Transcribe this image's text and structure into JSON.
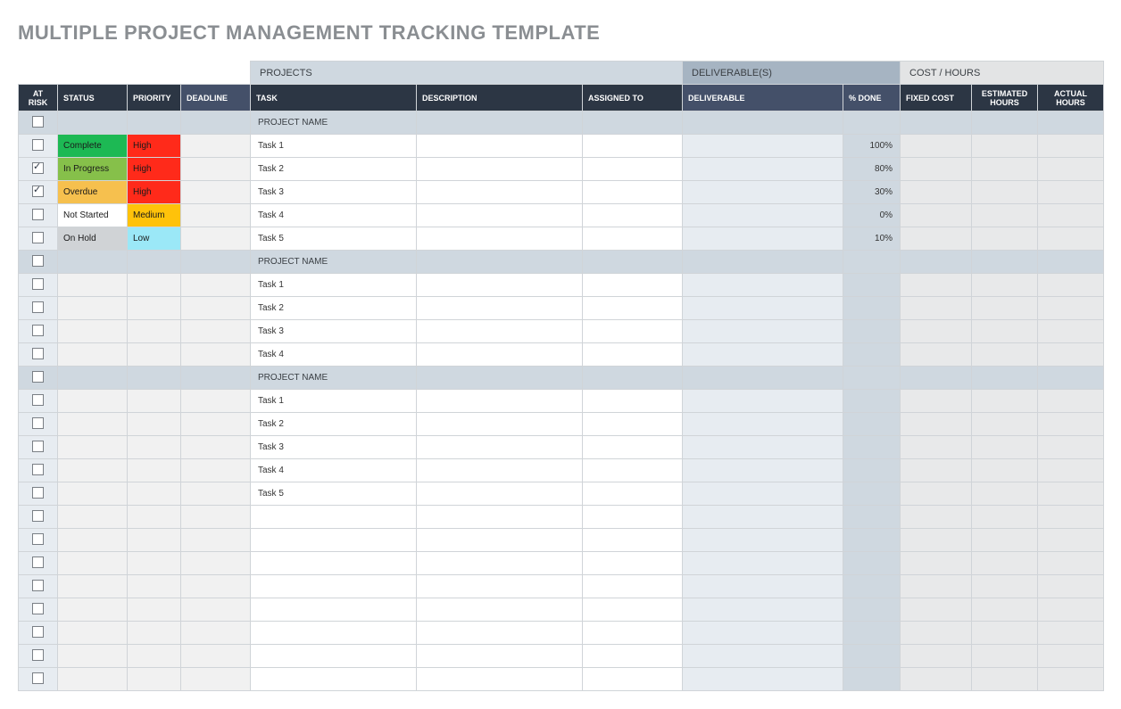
{
  "title": "MULTIPLE PROJECT MANAGEMENT TRACKING TEMPLATE",
  "groups": {
    "projects": "PROJECTS",
    "deliverables": "DELIVERABLE(S)",
    "cost": "COST / HOURS"
  },
  "columns": {
    "at_risk": "AT RISK",
    "status": "STATUS",
    "priority": "PRIORITY",
    "deadline": "DEADLINE",
    "task": "TASK",
    "description": "DESCRIPTION",
    "assigned_to": "ASSIGNED TO",
    "deliverable": "DELIVERABLE",
    "pct_done": "% DONE",
    "fixed_cost": "FIXED COST",
    "est_hours": "ESTIMATED HOURS",
    "actual_hours": "ACTUAL HOURS"
  },
  "status_labels": {
    "complete": "Complete",
    "in_progress": "In Progress",
    "overdue": "Overdue",
    "not_started": "Not Started",
    "on_hold": "On Hold"
  },
  "priority_labels": {
    "high": "High",
    "medium": "Medium",
    "low": "Low"
  },
  "section_label": "PROJECT NAME",
  "rows": [
    {
      "type": "section"
    },
    {
      "type": "task",
      "at_risk": false,
      "status": "complete",
      "priority": "high",
      "task": "Task 1",
      "pct_done": "100%"
    },
    {
      "type": "task",
      "at_risk": true,
      "status": "in_progress",
      "priority": "high",
      "task": "Task 2",
      "pct_done": "80%"
    },
    {
      "type": "task",
      "at_risk": true,
      "status": "overdue",
      "priority": "high",
      "task": "Task 3",
      "pct_done": "30%"
    },
    {
      "type": "task",
      "at_risk": false,
      "status": "not_started",
      "priority": "medium",
      "task": "Task 4",
      "pct_done": "0%"
    },
    {
      "type": "task",
      "at_risk": false,
      "status": "on_hold",
      "priority": "low",
      "task": "Task 5",
      "pct_done": "10%"
    },
    {
      "type": "section"
    },
    {
      "type": "task",
      "at_risk": false,
      "task": "Task 1"
    },
    {
      "type": "task",
      "at_risk": false,
      "task": "Task 2"
    },
    {
      "type": "task",
      "at_risk": false,
      "task": "Task 3"
    },
    {
      "type": "task",
      "at_risk": false,
      "task": "Task 4"
    },
    {
      "type": "section"
    },
    {
      "type": "task",
      "at_risk": false,
      "task": "Task 1"
    },
    {
      "type": "task",
      "at_risk": false,
      "task": "Task 2"
    },
    {
      "type": "task",
      "at_risk": false,
      "task": "Task 3"
    },
    {
      "type": "task",
      "at_risk": false,
      "task": "Task 4"
    },
    {
      "type": "task",
      "at_risk": false,
      "task": "Task 5"
    },
    {
      "type": "task",
      "at_risk": false
    },
    {
      "type": "task",
      "at_risk": false
    },
    {
      "type": "task",
      "at_risk": false
    },
    {
      "type": "task",
      "at_risk": false
    },
    {
      "type": "task",
      "at_risk": false
    },
    {
      "type": "task",
      "at_risk": false
    },
    {
      "type": "task",
      "at_risk": false
    },
    {
      "type": "task",
      "at_risk": false
    }
  ],
  "colors": {
    "status": {
      "complete": "#1db954",
      "in_progress": "#86c04a",
      "overdue": "#f6c04e",
      "not_started": "#ffffff",
      "on_hold": "#d0d3d6"
    },
    "priority": {
      "high": "#ff2a1a",
      "medium": "#ffc20a",
      "low": "#9be8f7"
    }
  }
}
